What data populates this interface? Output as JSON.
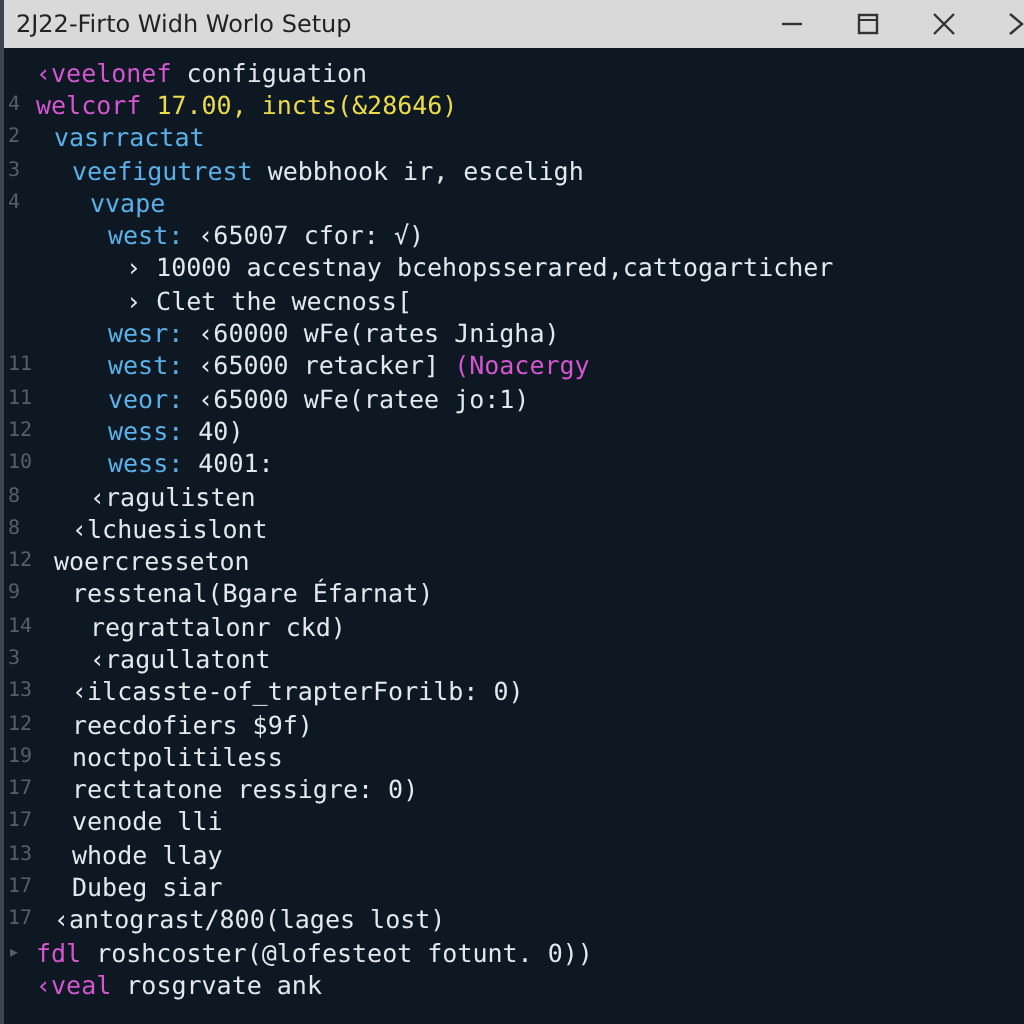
{
  "window": {
    "title": "2J22-Firto Widh Worlo Setup"
  },
  "editor": {
    "lines": [
      {
        "segments": [
          {
            "text": "‹veelonef",
            "color": "#d655d0"
          },
          {
            "text": "configuation",
            "color": "#e2e8ee"
          }
        ]
      },
      {
        "number": "4",
        "segments": [
          {
            "text": "welcorf",
            "color": "#d655d0"
          },
          {
            "text": "17.00, incts(&28646)",
            "color": "#ecdc4a"
          }
        ],
        "children": [
          {
            "number": "2",
            "segments": [
              {
                "text": "vasrractat",
                "color": "#5ab0e8"
              }
            ],
            "children": [
              {
                "number": "3",
                "segments": [
                  {
                    "text": "veefigutrest",
                    "color": "#5ab0e8"
                  },
                  {
                    "text": "webbhook ir, esceligh",
                    "color": "#e2e8ee"
                  }
                ],
                "children": [
                  {
                    "number": "4",
                    "segments": [
                      {
                        "text": "vvape",
                        "color": "#5ab0e8"
                      }
                    ],
                    "children": [
                      {
                        "segments": [
                          {
                            "text": "west:",
                            "color": "#5ab0e8"
                          },
                          {
                            "text": "‹65007 cfor: √)",
                            "color": "#e2e8ee"
                          }
                        ],
                        "children": [
                          {
                            "segments": [
                              {
                                "text": "› 10000 accestnay bcehopsserared‚cattogarticher",
                                "color": "#e2e8ee"
                              }
                            ]
                          },
                          {
                            "segments": [
                              {
                                "text": "› Clet the wecnoss[",
                                "color": "#e2e8ee"
                              }
                            ]
                          }
                        ]
                      },
                      {
                        "segments": [
                          {
                            "text": "wesr:",
                            "color": "#5ab0e8"
                          },
                          {
                            "text": "‹60000 wFe(rates Jnigha)",
                            "color": "#e2e8ee"
                          }
                        ]
                      },
                      {
                        "number": "11",
                        "segments": [
                          {
                            "text": "west:",
                            "color": "#5ab0e8"
                          },
                          {
                            "text": "‹65000 retacker]",
                            "color": "#e2e8ee"
                          },
                          {
                            "text": "(Noacergy",
                            "color": "#d655d0"
                          }
                        ]
                      },
                      {
                        "number": "11",
                        "segments": [
                          {
                            "text": "veor:",
                            "color": "#5ab0e8"
                          },
                          {
                            "text": "‹65000 wFe(ratee jo:1)",
                            "color": "#e2e8ee"
                          }
                        ]
                      },
                      {
                        "number": "12",
                        "segments": [
                          {
                            "text": "wess:",
                            "color": "#5ab0e8"
                          },
                          {
                            "text": "40)",
                            "color": "#e2e8ee"
                          }
                        ]
                      },
                      {
                        "number": "10",
                        "segments": [
                          {
                            "text": "wess:",
                            "color": "#5ab0e8"
                          },
                          {
                            "text": "4001:",
                            "color": "#e2e8ee"
                          }
                        ]
                      }
                    ]
                  },
                  {
                    "number": "8",
                    "segments": [
                      {
                        "text": "‹ragulisten",
                        "color": "#e2e8ee"
                      }
                    ]
                  }
                ]
              },
              {
                "number": "8",
                "segments": [
                  {
                    "text": "‹lchuesislont",
                    "color": "#e2e8ee"
                  }
                ]
              }
            ]
          },
          {
            "number": "12",
            "segments": [
              {
                "text": "woercresseton",
                "color": "#e2e8ee"
              }
            ],
            "children": [
              {
                "number": "9",
                "segments": [
                  {
                    "text": "resstenal(Bgare Éfarnat)",
                    "color": "#e2e8ee"
                  }
                ],
                "children": [
                  {
                    "number": "14",
                    "segments": [
                      {
                        "text": "regrattalonr ckd)",
                        "color": "#e2e8ee"
                      }
                    ]
                  },
                  {
                    "number": "3",
                    "segments": [
                      {
                        "text": "‹ragullatont",
                        "color": "#e2e8ee"
                      }
                    ]
                  }
                ]
              },
              {
                "number": "13",
                "segments": [
                  {
                    "text": "‹ilcasste-of_trapterForilb: 0)",
                    "color": "#e2e8ee"
                  }
                ]
              },
              {
                "number": "12",
                "segments": [
                  {
                    "text": "reecdofiers $9f)",
                    "color": "#e2e8ee"
                  }
                ]
              },
              {
                "number": "19",
                "segments": [
                  {
                    "text": "noctpolitiless",
                    "color": "#e2e8ee"
                  }
                ]
              },
              {
                "number": "17",
                "segments": [
                  {
                    "text": "recttatone ressigre: 0)",
                    "color": "#e2e8ee"
                  }
                ]
              },
              {
                "number": "17",
                "segments": [
                  {
                    "text": "venode lli",
                    "color": "#e2e8ee"
                  }
                ]
              },
              {
                "number": "13",
                "segments": [
                  {
                    "text": "whode llay",
                    "color": "#e2e8ee"
                  }
                ]
              },
              {
                "number": "17",
                "segments": [
                  {
                    "text": "Dubeg siar",
                    "color": "#e2e8ee"
                  }
                ]
              }
            ]
          },
          {
            "number": "17",
            "segments": [
              {
                "text": "‹antograst/800(lages lost)",
                "color": "#e2e8ee"
              }
            ]
          }
        ]
      },
      {
        "number": "▸",
        "segments": [
          {
            "text": "fdl",
            "color": "#d655d0"
          },
          {
            "text": "roshcoster(@lofesteot fotunt. 0))",
            "color": "#e2e8ee"
          }
        ]
      },
      {
        "segments": [
          {
            "text": "‹veal",
            "color": "#d655d0"
          },
          {
            "text": "rosgrvate ank",
            "color": "#e2e8ee"
          }
        ]
      }
    ]
  }
}
